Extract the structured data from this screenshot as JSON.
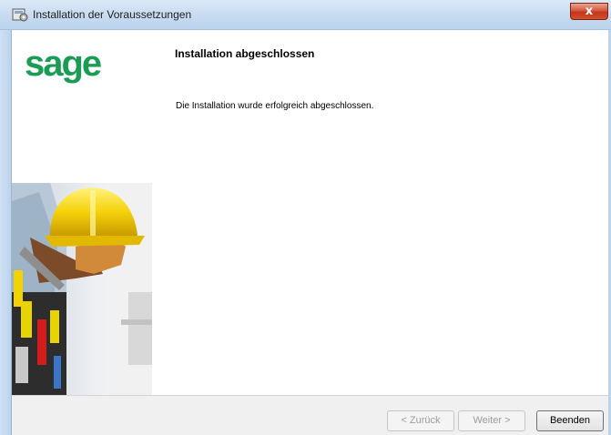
{
  "window": {
    "title": "Installation der Voraussetzungen",
    "close_label": "x"
  },
  "sidebar": {
    "logo_text": "sage",
    "logo_color": "#1b9c55",
    "image": "construction-worker-with-hard-hat"
  },
  "main": {
    "heading": "Installation abgeschlossen",
    "message": "Die Installation wurde erfolgreich abgeschlossen."
  },
  "buttons": {
    "back": "< Zurück",
    "next": "Weiter >",
    "finish": "Beenden"
  }
}
